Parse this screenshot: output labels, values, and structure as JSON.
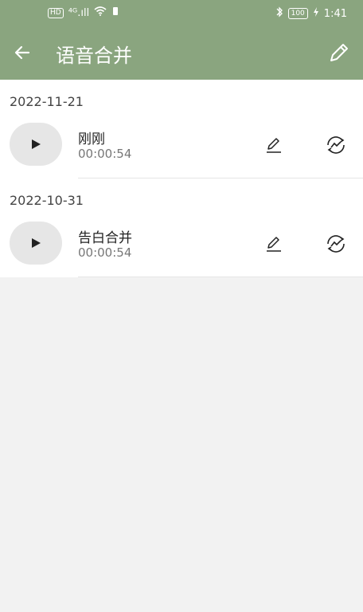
{
  "status_bar": {
    "left_hd": "HD",
    "left_signal": "⁴ᴳ.ıll",
    "time": "1:41",
    "battery": "100"
  },
  "header": {
    "title": "语音合并"
  },
  "groups": [
    {
      "date": "2022-11-21",
      "items": [
        {
          "name": "刚刚",
          "duration": "00:00:54"
        }
      ]
    },
    {
      "date": "2022-10-31",
      "items": [
        {
          "name": "告白合并",
          "duration": "00:00:54"
        }
      ]
    }
  ],
  "colors": {
    "header_bg": "#8aa57f",
    "page_bg": "#f2f2f2",
    "card_bg": "#ffffff"
  }
}
